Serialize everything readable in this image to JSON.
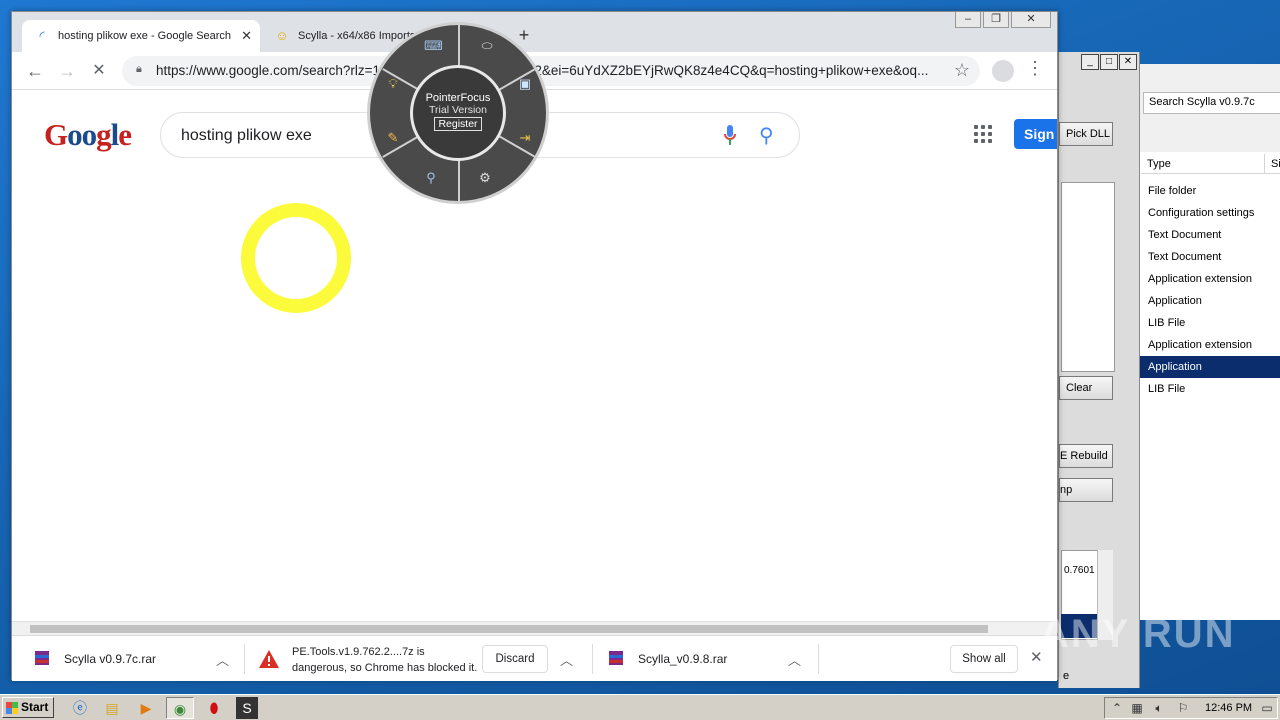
{
  "chrome": {
    "tabs": [
      {
        "title": "hosting plikow exe - Google Search",
        "active": true
      },
      {
        "title": "Scylla - x64/x86 Imports Reconstruc",
        "active": false
      }
    ],
    "url": "https://www.google.com/search?rlz=1C1GGRV_enUA812UA812&ei=6uYdXZ2bEYjRwQK8z4e4CQ&q=hosting+plikow+exe&oq...",
    "search_query": "hosting plikow exe",
    "signin_label": "Sign",
    "logo_text": "Google"
  },
  "pointerfocus": {
    "title": "PointerFocus",
    "trial": "Trial Version",
    "register": "Register"
  },
  "downloads": {
    "item1": "Scylla v0.9.7c.rar",
    "warning_line1": "PE.Tools.v1.9.762.2....7z is",
    "warning_line2": "dangerous, so Chrome has blocked it.",
    "discard": "Discard",
    "item3": "Scylla_v0.9.8.rar",
    "show_all": "Show all"
  },
  "explorer": {
    "search_placeholder": "Search Scylla v0.9.7c",
    "col_type": "Type",
    "col_size": "Siz",
    "types": [
      "File folder",
      "Configuration settings",
      "Text Document",
      "Text Document",
      "Application extension",
      "Application",
      "LIB File",
      "Application extension",
      "Application",
      "LIB File"
    ],
    "selected_index": 8
  },
  "scylla": {
    "pick_dll": "Pick DLL",
    "clear": "Clear",
    "pe_rebuild": "E Rebuild",
    "dump": "np",
    "log_text": "0.7601",
    "status": "e"
  },
  "watermark": "ANY RUN",
  "taskbar": {
    "start": "Start",
    "clock": "12:46 PM"
  }
}
